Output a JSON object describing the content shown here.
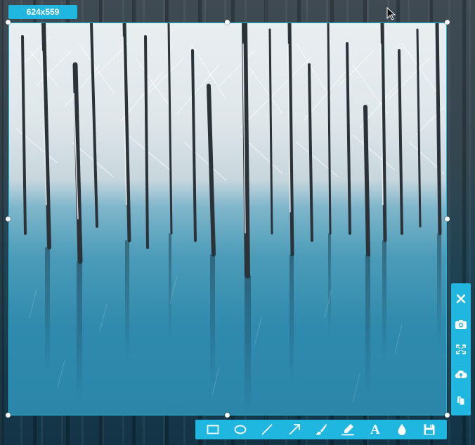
{
  "selection": {
    "size_label": "624x559"
  },
  "side_toolbar": {
    "items": [
      {
        "icon": "close-icon"
      },
      {
        "icon": "camera-icon"
      },
      {
        "icon": "fullscreen-icon"
      },
      {
        "icon": "cloud-upload-icon"
      },
      {
        "icon": "copy-icon"
      }
    ]
  },
  "bottom_toolbar": {
    "text_tool_label": "A",
    "items": [
      {
        "icon": "rectangle-icon"
      },
      {
        "icon": "ellipse-icon"
      },
      {
        "icon": "line-icon"
      },
      {
        "icon": "arrow-icon"
      },
      {
        "icon": "brush-icon"
      },
      {
        "icon": "marker-icon"
      },
      {
        "icon": "text-icon"
      },
      {
        "icon": "blur-drop-icon"
      },
      {
        "icon": "save-icon"
      }
    ]
  },
  "colors": {
    "accent": "#1fb6e0"
  }
}
